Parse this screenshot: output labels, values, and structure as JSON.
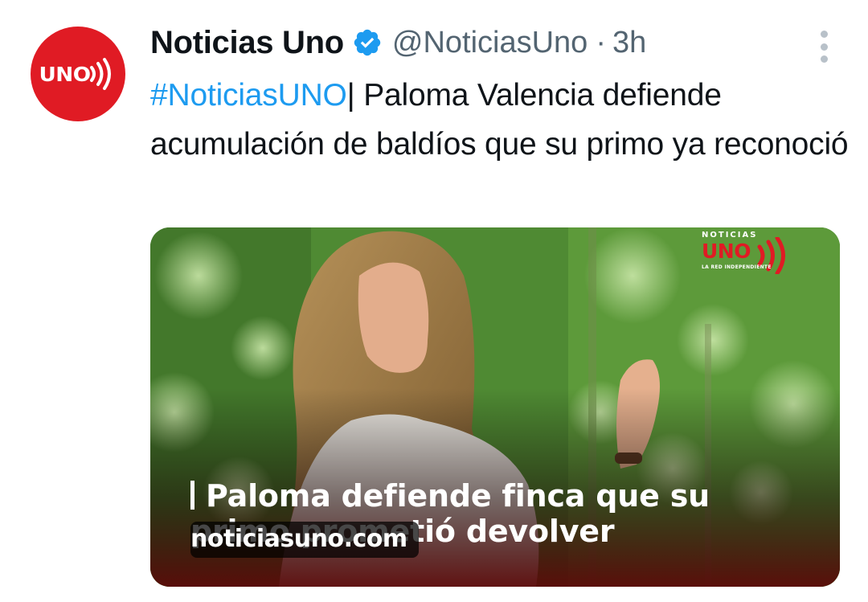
{
  "account": {
    "display_name": "Noticias Uno",
    "handle": "@NoticiasUno",
    "separator": "·",
    "time_ago": "3h",
    "avatar_text": "UNO",
    "avatar_color": "#e01b24",
    "verified_color": "#1d9bf0",
    "verified_icon": "verified-badge-icon"
  },
  "tweet": {
    "hashtag": "#NoticiasUNO",
    "text": "| Paloma Valencia defiende acumulación de baldíos que su primo ya reconoció"
  },
  "media": {
    "logo_small": "NOTICIAS",
    "logo_main": "UNO",
    "logo_tagline": "LA RED INDEPENDIENTE",
    "headline_line1": "Paloma defiende finca que su",
    "headline_line2": "primo prometió devolver",
    "domain": "noticiasuno.com"
  },
  "menu": {
    "icon": "more-vertical-icon"
  }
}
